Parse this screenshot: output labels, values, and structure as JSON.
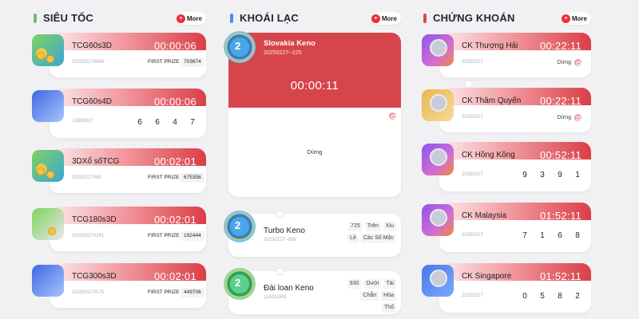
{
  "columns": [
    {
      "title": "SIÊU TỐC",
      "bar_color": "#6dbf6a",
      "more_label": "More",
      "cards": [
        {
          "name": "TCG60s3D",
          "timer": "00:00:06",
          "draw_id": "202502270886",
          "prize_label": "FIRST PRIZE",
          "prize_value": "703674",
          "thumb": "red"
        },
        {
          "name": "TCG60s4D",
          "timer": "00:00:06",
          "draw_id": "12885837",
          "digits": [
            "6",
            "6",
            "4",
            "7"
          ],
          "thumb": "dice"
        },
        {
          "name": "3DXổ sốTCG",
          "timer": "00:02:01",
          "draw_id": "20250227089",
          "prize_label": "FIRST PRIZE",
          "prize_value": "675358",
          "thumb": "red"
        },
        {
          "name": "TCG180s3D",
          "timer": "00:02:01",
          "draw_id": "202502270291",
          "prize_label": "FIRST PRIZE",
          "prize_value": "192444",
          "thumb": "red"
        },
        {
          "name": "TCG300s3D",
          "timer": "00:02:01",
          "draw_id": "202502270175",
          "prize_label": "FIRST PRIZE",
          "prize_value": "449706",
          "thumb": "dice"
        }
      ]
    },
    {
      "title": "KHOÁI LẠC",
      "bar_color": "#4a8ee8",
      "more_label": "More",
      "featured": {
        "name": "Slovakia Keno",
        "draw_id": "20250227--225",
        "timer": "00:00:11",
        "status": "Dừng"
      },
      "kcards": [
        {
          "name": "Turbo Keno",
          "draw_id": "20250227--889",
          "tags": [
            "725",
            "Trên",
            "Xỉu",
            "Lẻ",
            "Các Số Mộc"
          ]
        },
        {
          "name": "Đài loan Keno",
          "draw_id": "114011661",
          "tags": [
            "930",
            "Dưới",
            "Tài",
            "Chẵn",
            "Hòa",
            "Thổ"
          ]
        }
      ]
    },
    {
      "title": "CHỨNG KHOÁN",
      "bar_color": "#e0474e",
      "more_label": "More",
      "cards": [
        {
          "name": "CK Thượng Hải",
          "timer": "00:22:11",
          "draw_id": "20250227",
          "status": "Dừng",
          "thumb": "purple"
        },
        {
          "name": "CK Thâm Quyến",
          "timer": "00:22:11",
          "draw_id": "20250227",
          "status": "Dừng",
          "thumb": "gold"
        },
        {
          "name": "CK Hồng Kông",
          "timer": "00:52:11",
          "draw_id": "20250227",
          "digits": [
            "9",
            "3",
            "9",
            "1"
          ],
          "thumb": "purple"
        },
        {
          "name": "CK Malaysia",
          "timer": "01:52:11",
          "draw_id": "20250227",
          "digits": [
            "7",
            "1",
            "6",
            "8"
          ],
          "thumb": "purple"
        },
        {
          "name": "CK Singapore",
          "timer": "01:52:11",
          "draw_id": "20250227",
          "digits": [
            "0",
            "5",
            "8",
            "2"
          ],
          "thumb": "blue"
        }
      ]
    }
  ],
  "icons": {
    "more": "more-badge-icon",
    "lock": "lock-icon"
  },
  "colors": {
    "accent_red": "#d6454b",
    "timer_text": "#ffffff"
  }
}
